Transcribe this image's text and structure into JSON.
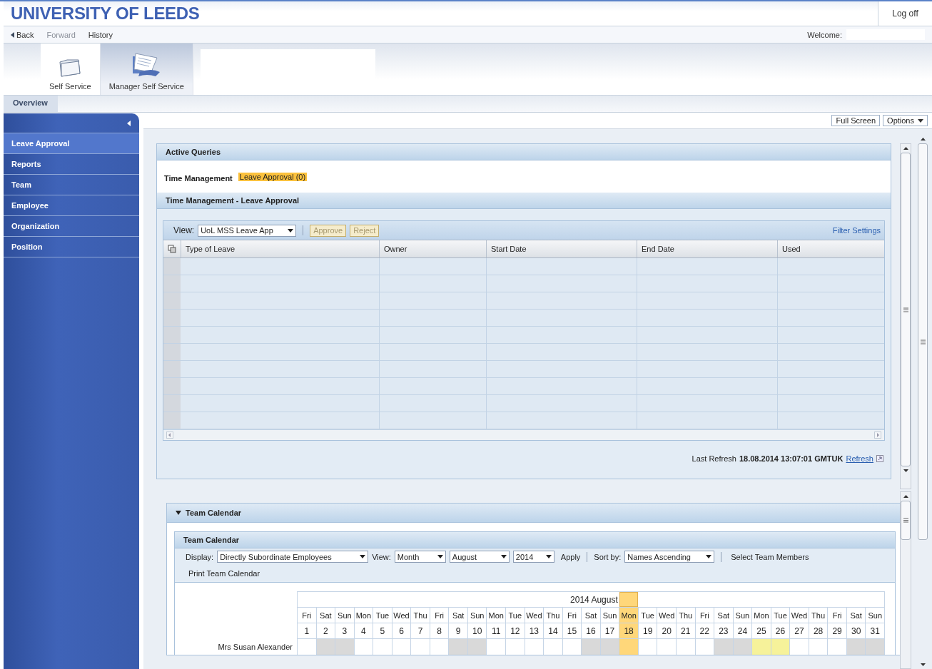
{
  "header": {
    "title": "UNIVERSITY OF LEEDS",
    "logoff": "Log off"
  },
  "nav": {
    "items": [
      {
        "label": "Back",
        "kind": "back",
        "disabled": false
      },
      {
        "label": "Forward",
        "kind": "plain",
        "disabled": true
      },
      {
        "label": "History",
        "kind": "plain",
        "disabled": false
      }
    ],
    "welcome": "Welcome:"
  },
  "roles": [
    {
      "label": "Self Service",
      "kind": "folder",
      "selected": false
    },
    {
      "label": "Manager Self Service",
      "kind": "documents",
      "selected": true
    }
  ],
  "subtabs": [
    {
      "label": "Overview",
      "selected": true
    }
  ],
  "sidebar": {
    "items": [
      {
        "label": "Leave Approval",
        "selected": true
      },
      {
        "label": "Reports",
        "selected": false
      },
      {
        "label": "Team",
        "selected": false
      },
      {
        "label": "Employee",
        "selected": false
      },
      {
        "label": "Organization",
        "selected": false
      },
      {
        "label": "Position",
        "selected": false
      }
    ]
  },
  "toolbar": {
    "buttons": [
      {
        "label": "Full Screen",
        "kind": "plain"
      },
      {
        "label": "Options",
        "kind": "menu"
      }
    ]
  },
  "active_queries": {
    "title": "Active Queries",
    "label": "Time Management",
    "badge": "Leave Approval (0)"
  },
  "leave_approval": {
    "title": "Time Management - Leave Approval",
    "view_label": "View:",
    "view_value": "UoL MSS Leave App",
    "buttons": [
      {
        "label": "Approve",
        "disabled": true
      },
      {
        "label": "Reject",
        "disabled": true
      }
    ],
    "filter": "Filter Settings",
    "columns": [
      "Type of Leave",
      "Owner",
      "Start Date",
      "End Date",
      "Used"
    ],
    "refresh_label": "Last Refresh",
    "refresh_time": "18.08.2014 13:07:01 GMTUK",
    "refresh_link": "Refresh"
  },
  "team_calendar": {
    "title": "Team Calendar",
    "expanded": true,
    "subtitle": "Team Calendar",
    "display_label": "Display:",
    "display_value": "Directly Subordinate Employees",
    "view_label": "View:",
    "view_value": "Month",
    "month": "August",
    "year": "2014",
    "apply": "Apply",
    "sort_label": "Sort by:",
    "sort_value": "Names Ascending",
    "select_members": "Select Team Members",
    "print": "Print Team Calendar",
    "month_heading": "2014 August",
    "days": [
      {
        "name": "Fri",
        "date": "1",
        "today": false,
        "weekend": false
      },
      {
        "name": "Sat",
        "date": "2",
        "today": false,
        "weekend": true
      },
      {
        "name": "Sun",
        "date": "3",
        "today": false,
        "weekend": true
      },
      {
        "name": "Mon",
        "date": "4",
        "today": false,
        "weekend": false
      },
      {
        "name": "Tue",
        "date": "5",
        "today": false,
        "weekend": false
      },
      {
        "name": "Wed",
        "date": "6",
        "today": false,
        "weekend": false
      },
      {
        "name": "Thu",
        "date": "7",
        "today": false,
        "weekend": false
      },
      {
        "name": "Fri",
        "date": "8",
        "today": false,
        "weekend": false
      },
      {
        "name": "Sat",
        "date": "9",
        "today": false,
        "weekend": true
      },
      {
        "name": "Sun",
        "date": "10",
        "today": false,
        "weekend": true
      },
      {
        "name": "Mon",
        "date": "11",
        "today": false,
        "weekend": false
      },
      {
        "name": "Tue",
        "date": "12",
        "today": false,
        "weekend": false
      },
      {
        "name": "Wed",
        "date": "13",
        "today": false,
        "weekend": false
      },
      {
        "name": "Thu",
        "date": "14",
        "today": false,
        "weekend": false
      },
      {
        "name": "Fri",
        "date": "15",
        "today": false,
        "weekend": false
      },
      {
        "name": "Sat",
        "date": "16",
        "today": false,
        "weekend": true
      },
      {
        "name": "Sun",
        "date": "17",
        "today": false,
        "weekend": true
      },
      {
        "name": "Mon",
        "date": "18",
        "today": true,
        "weekend": false
      },
      {
        "name": "Tue",
        "date": "19",
        "today": false,
        "weekend": false
      },
      {
        "name": "Wed",
        "date": "20",
        "today": false,
        "weekend": false
      },
      {
        "name": "Thu",
        "date": "21",
        "today": false,
        "weekend": false
      },
      {
        "name": "Fri",
        "date": "22",
        "today": false,
        "weekend": false
      },
      {
        "name": "Sat",
        "date": "23",
        "today": false,
        "weekend": true
      },
      {
        "name": "Sun",
        "date": "24",
        "today": false,
        "weekend": true
      },
      {
        "name": "Mon",
        "date": "25",
        "today": false,
        "weekend": false
      },
      {
        "name": "Tue",
        "date": "26",
        "today": false,
        "weekend": false
      },
      {
        "name": "Wed",
        "date": "27",
        "today": false,
        "weekend": false
      },
      {
        "name": "Thu",
        "date": "28",
        "today": false,
        "weekend": false
      },
      {
        "name": "Fri",
        "date": "29",
        "today": false,
        "weekend": false
      },
      {
        "name": "Sat",
        "date": "30",
        "today": false,
        "weekend": true
      },
      {
        "name": "Sun",
        "date": "31",
        "today": false,
        "weekend": true
      }
    ],
    "employees": [
      {
        "name": "Mrs Susan Alexander",
        "days": [
          {
            "absent": false
          },
          {
            "absent": false
          },
          {
            "absent": false
          },
          {
            "absent": false
          },
          {
            "absent": false
          },
          {
            "absent": false
          },
          {
            "absent": false
          },
          {
            "absent": false
          },
          {
            "absent": false
          },
          {
            "absent": false
          },
          {
            "absent": false
          },
          {
            "absent": false
          },
          {
            "absent": false
          },
          {
            "absent": false
          },
          {
            "absent": false
          },
          {
            "absent": false
          },
          {
            "absent": false
          },
          {
            "absent": false
          },
          {
            "absent": false
          },
          {
            "absent": false
          },
          {
            "absent": false
          },
          {
            "absent": false
          },
          {
            "absent": false
          },
          {
            "absent": false
          },
          {
            "absent": true
          },
          {
            "absent": true
          },
          {
            "absent": false
          },
          {
            "absent": false
          },
          {
            "absent": false
          },
          {
            "absent": false
          },
          {
            "absent": false
          }
        ]
      }
    ]
  }
}
